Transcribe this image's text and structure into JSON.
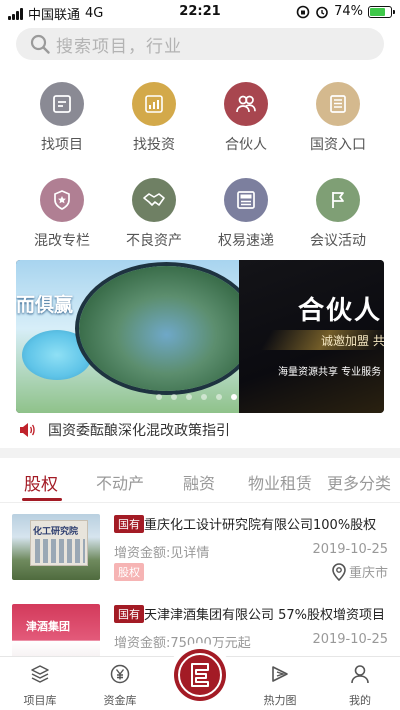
{
  "status_bar": {
    "carrier": "中国联通",
    "network": "4G",
    "time": "22:21",
    "battery": "74%",
    "battery_level": 0.74
  },
  "search": {
    "placeholder": "搜索项目，行业"
  },
  "quick_menu": [
    {
      "label": "找项目",
      "icon": "document-icon",
      "color": "#8a8a94"
    },
    {
      "label": "找投资",
      "icon": "bar-chart-icon",
      "color": "#d3a94a"
    },
    {
      "label": "合伙人",
      "icon": "people-icon",
      "color": "#a8464f"
    },
    {
      "label": "国资入口",
      "icon": "building-doc-icon",
      "color": "#d4b98e"
    },
    {
      "label": "混改专栏",
      "icon": "shield-star-icon",
      "color": "#b07f93"
    },
    {
      "label": "不良资产",
      "icon": "handshake-icon",
      "color": "#6f8064"
    },
    {
      "label": "权易速递",
      "icon": "news-icon",
      "color": "#7c7f9e"
    },
    {
      "label": "会议活动",
      "icon": "flag-icon",
      "color": "#7f9f75"
    }
  ],
  "banner": {
    "left_text": "而俱赢",
    "headline": "合伙人",
    "subline": "诚邀加盟 共",
    "tagline": "海量资源共享 专业服务",
    "slide_count": 6,
    "active_slide": 6
  },
  "notice": {
    "text": "国资委酝酿深化混改政策指引",
    "icon": "speaker-icon"
  },
  "tabs": [
    "股权",
    "不动产",
    "融资",
    "物业租赁",
    "更多分类"
  ],
  "active_tab": "股权",
  "listings": [
    {
      "tag": "国有",
      "title": "重庆化工设计研究院有限公司100%股权",
      "amount": "增资金额:见详情",
      "date": "2019-10-25",
      "category": "股权",
      "location": "重庆市",
      "thumb_text": "化工研究院"
    },
    {
      "tag": "国有",
      "title": "天津津酒集团有限公司 57%股权增资项目",
      "amount": "增资金额:75000万元起",
      "date": "2019-10-25",
      "thumb_text": "津酒集团"
    }
  ],
  "bottom_nav": [
    {
      "label": "项目库",
      "icon": "layers-icon"
    },
    {
      "label": "资金库",
      "icon": "yen-icon"
    },
    {
      "label": "",
      "icon": "brand-logo-icon"
    },
    {
      "label": "热力图",
      "icon": "heatmap-icon"
    },
    {
      "label": "我的",
      "icon": "person-icon"
    }
  ]
}
